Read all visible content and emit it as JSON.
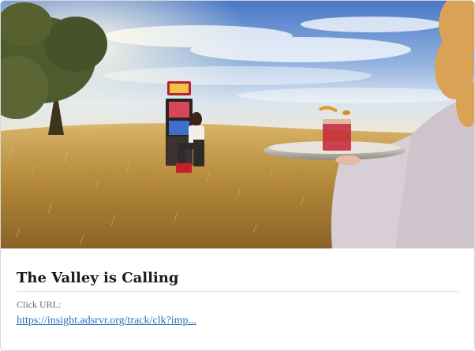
{
  "ad": {
    "title": "The Valley is Calling",
    "click_url_label": "Click URL:",
    "click_url": "https://insight.adsrvr.org/track/clk?imp..."
  },
  "image": {
    "subject": "ad-creative-photo"
  },
  "colors": {
    "link": "#2a6fbf",
    "title": "#1a1a1a",
    "label": "#6b6b6b"
  }
}
